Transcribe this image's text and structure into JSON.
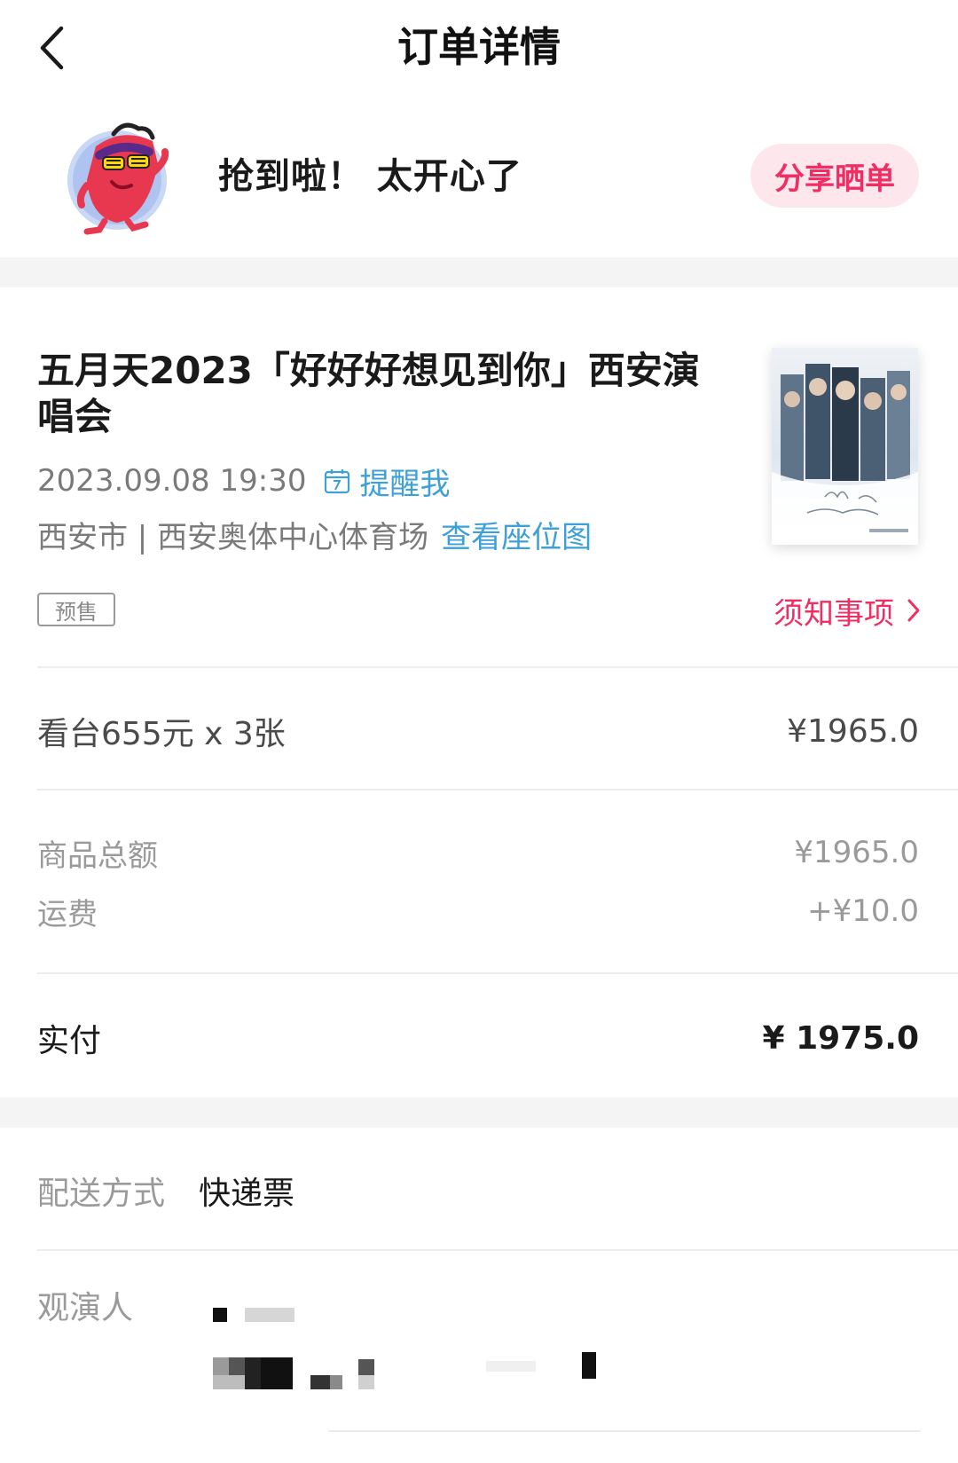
{
  "header": {
    "title": "订单详情",
    "back_icon": "chevron-left-icon"
  },
  "banner": {
    "message": "抢到啦！ 太开心了",
    "share_label": "分享晒单",
    "mascot_icon": "mascot-icon"
  },
  "event": {
    "title": "五月天2023「好好好想见到你」西安演唱会",
    "datetime": "2023.09.08 19:30",
    "remind_label": "提醒我",
    "venue": "西安市 | 西安奥体中心体育场",
    "seat_map_label": "查看座位图",
    "presale_badge": "预售",
    "notice_label": "须知事项"
  },
  "order": {
    "ticket_line": "看台655元 x 3张",
    "ticket_amount": "¥1965.0",
    "subtotal_label": "商品总额",
    "subtotal_value": "¥1965.0",
    "shipping_label": "运费",
    "shipping_value": "+¥10.0",
    "paid_label": "实付",
    "paid_value": "¥ 1975.0"
  },
  "delivery": {
    "label": "配送方式",
    "value": "快递票"
  },
  "viewer": {
    "label": "观演人"
  },
  "colors": {
    "accent_pink": "#ef2f64",
    "link_blue": "#3da0d8",
    "share_bg": "#fde6ec"
  }
}
